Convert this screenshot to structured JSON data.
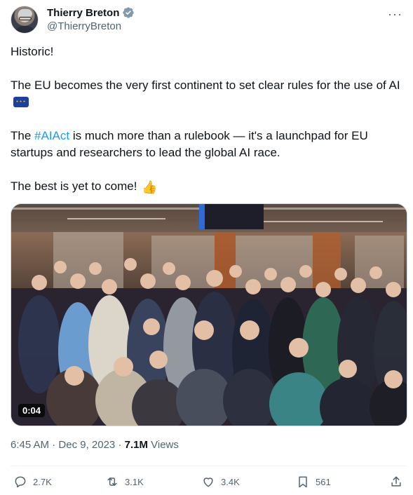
{
  "author": {
    "display_name": "Thierry Breton",
    "handle": "@ThierryBreton",
    "verified_icon": "verified-badge-icon",
    "avatar": "profile-photo"
  },
  "more_icon": "more-options-icon",
  "tweet": {
    "line1": "Historic!",
    "line2_a": "The EU becomes the very first continent to set clear rules for the use of AI",
    "emoji_flag": "eu-flag-icon",
    "line3_pre": "The ",
    "hashtag": "#AIAct",
    "line3_post": " is much more than a rulebook — it's a launchpad for EU startups and researchers to lead the global AI race.",
    "line4": "The best is yet to come!",
    "emoji_thumbs": "thumbs-up-icon"
  },
  "media": {
    "type": "video",
    "duration": "0:04"
  },
  "meta": {
    "time": "6:45 AM",
    "separator": " · ",
    "date": "Dec 9, 2023",
    "views_count": "7.1M",
    "views_label": " Views"
  },
  "actions": {
    "replies": "2.7K",
    "reposts": "3.1K",
    "likes": "3.4K",
    "bookmarks": "561"
  },
  "colors": {
    "accent": "#1d9bf0",
    "text": "#0f1419",
    "secondary": "#536471"
  }
}
